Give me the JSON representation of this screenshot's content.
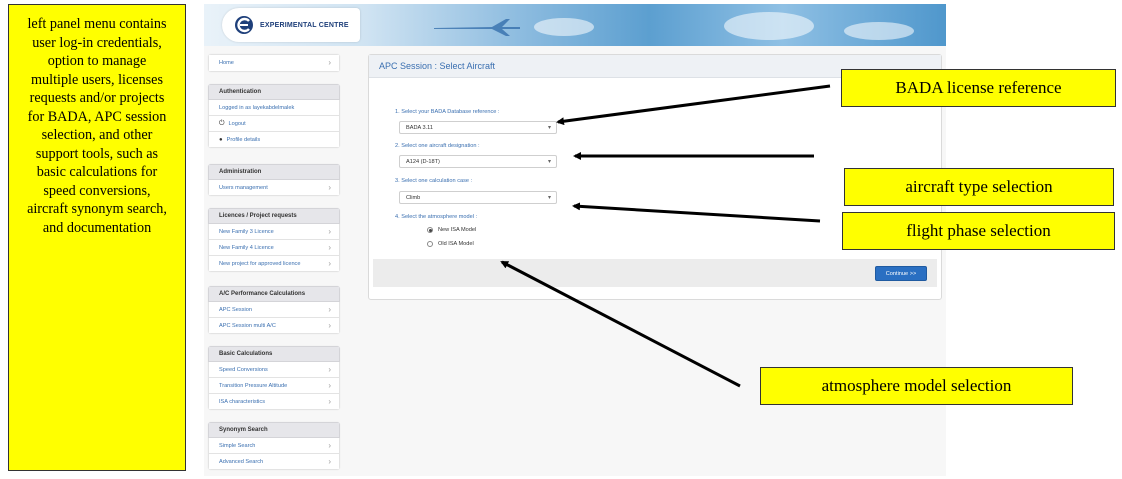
{
  "notes": {
    "left_panel": "left panel menu contains user log-in credentials, option to manage multiple users, licenses requests and/or projects for BADA, APC session selection, and other support tools, such as basic calculations for speed conversions, aircraft synonym search, and documentation",
    "bada_license": "BADA license reference",
    "aircraft_type": "aircraft type selection",
    "flight_phase": "flight phase selection",
    "atmosphere_model": "atmosphere model selection"
  },
  "banner": {
    "logo_text": "EXPERIMENTAL CENTRE",
    "logo_icon": "eurocontrol-logo-icon"
  },
  "sidebar": {
    "home": "Home",
    "authentication": {
      "header": "Authentication",
      "logged_in": "Logged in as layekabdelmalek",
      "logout": "Logout",
      "profile": "Profile details"
    },
    "administration": {
      "header": "Administration",
      "users_management": "Users management"
    },
    "licences": {
      "header": "Licences / Project requests",
      "items": [
        "New Family 3 Licence",
        "New Family 4 Licence",
        "New project for approved licence"
      ]
    },
    "apc": {
      "header": "A/C Performance Calculations",
      "items": [
        "APC Session",
        "APC Session multi A/C"
      ]
    },
    "basic": {
      "header": "Basic Calculations",
      "items": [
        "Speed Conversions",
        "Transition Pressure Altitude",
        "ISA characteristics"
      ]
    },
    "synonym": {
      "header": "Synonym Search",
      "items": [
        "Simple Search",
        "Advanced Search"
      ]
    }
  },
  "panel": {
    "title": "APC Session : Select Aircraft",
    "q1": "1. Select your BADA Database reference :",
    "bada_value": "BADA 3.11",
    "q2": "2. Select one aircraft designation :",
    "aircraft_value": "A124 (D-18T)",
    "q3": "3. Select one calculation case :",
    "case_value": "Climb",
    "q4": "4. Select the atmosphere model :",
    "radio_new": "New ISA Model",
    "radio_old": "Old ISA Model",
    "radio_selected": "New ISA Model",
    "continue": "Continue >>"
  },
  "colors": {
    "callout": "#ffff00",
    "link": "#3a6fb0",
    "button": "#2a6fc2"
  }
}
